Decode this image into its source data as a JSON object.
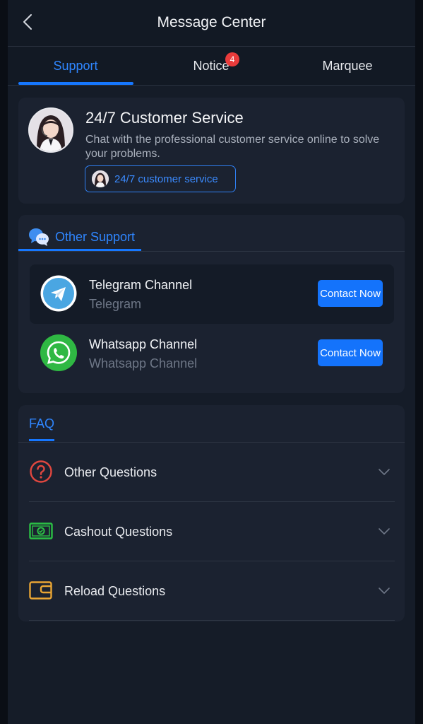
{
  "header": {
    "title": "Message Center",
    "back_icon": "chevron-left-icon"
  },
  "tabs": [
    {
      "label": "Support",
      "active": true
    },
    {
      "label": "Notice",
      "badge": "4"
    },
    {
      "label": "Marquee"
    }
  ],
  "customer_service": {
    "title": "24/7 Customer Service",
    "description": "Chat with the professional customer service online to solve your problems.",
    "button_label": "24/7 customer service"
  },
  "other_support": {
    "tab_label": "Other Support",
    "channels": [
      {
        "title": "Telegram Channel",
        "subtitle": "Telegram",
        "button": "Contact Now",
        "icon": "telegram-icon"
      },
      {
        "title": "Whatsapp Channel",
        "subtitle": "Whatsapp Channel",
        "button": "Contact Now",
        "icon": "whatsapp-icon"
      }
    ]
  },
  "faq": {
    "tab_label": "FAQ",
    "items": [
      {
        "label": "Other Questions",
        "icon": "question-circle-icon"
      },
      {
        "label": "Cashout Questions",
        "icon": "cash-icon"
      },
      {
        "label": "Reload Questions",
        "icon": "wallet-icon"
      }
    ]
  },
  "colors": {
    "accent": "#1677ff",
    "badge": "#ea3b3b",
    "background": "#151c28",
    "card": "#1b2230"
  }
}
